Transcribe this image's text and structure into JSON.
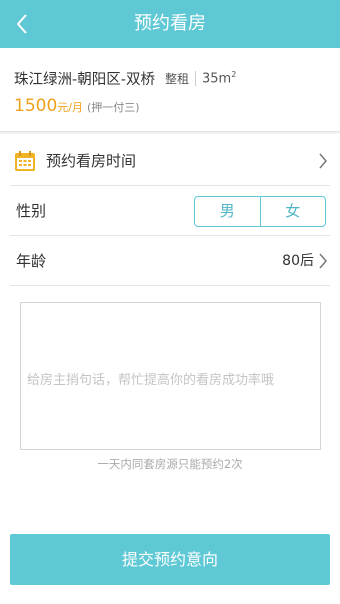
{
  "header": {
    "title": "预约看房",
    "back_icon": "chevron-left-icon",
    "color": "#5ec8d5"
  },
  "listing": {
    "name": "珠江绿洲-朝阳区-双桥",
    "rent_type": "整租",
    "area": "35m",
    "area_sup": "2",
    "price": "1500",
    "price_unit": "元/月",
    "payment_note": "(押一付三)",
    "price_color": "#f0a11b"
  },
  "form": {
    "time_row": {
      "label": "预约看房时间",
      "icon": "calendar-icon",
      "icon_color": "#f0b323"
    },
    "gender_row": {
      "label": "性别",
      "options": [
        "男",
        "女"
      ]
    },
    "age_row": {
      "label": "年龄",
      "value": "80后"
    },
    "message": {
      "placeholder": "给房主捎句话，帮忙提高你的看房成功率哦",
      "value": ""
    },
    "limit_hint": "一天内同套房源只能预约2次",
    "submit_label": "提交预约意向"
  }
}
